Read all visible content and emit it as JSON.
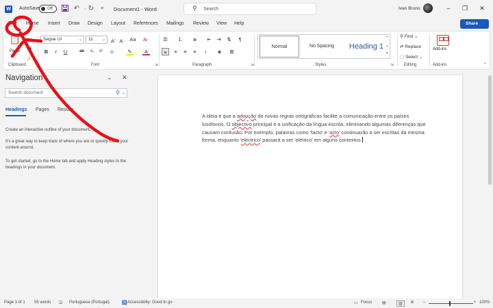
{
  "titlebar": {
    "autosave_label": "AutoSave",
    "autosave_state": "Off",
    "doc_title": "Document1  -  Word",
    "search_placeholder": "Search",
    "user_name": "Ivan Bruno",
    "save_icon": "save-icon",
    "undo_icon": "undo-icon",
    "redo_icon": "redo-icon"
  },
  "menu": {
    "tabs": [
      "File",
      "Home",
      "Insert",
      "Draw",
      "Design",
      "Layout",
      "References",
      "Mailings",
      "Review",
      "View",
      "Help"
    ],
    "share_label": "Share"
  },
  "ribbon": {
    "clipboard": {
      "label": "Clipboard",
      "paste_label": "Paste"
    },
    "font": {
      "label": "Font",
      "font_name": "Segoe UI",
      "font_size": "11",
      "change_case": "Aa"
    },
    "paragraph": {
      "label": "Paragraph"
    },
    "styles": {
      "label": "Styles",
      "items": [
        "Normal",
        "No Spacing",
        "Heading 1"
      ]
    },
    "editing": {
      "label": "Editing",
      "find": "Find",
      "replace": "Replace",
      "select": "Select"
    },
    "addins": {
      "label": "Add-ins",
      "button_label": "Add-ins"
    },
    "accent_color": "#185abd"
  },
  "nav": {
    "title": "Navigation",
    "search_placeholder": "Search document",
    "tabs": [
      "Headings",
      "Pages",
      "Results"
    ],
    "active_tab": "Headings",
    "texts": [
      "Create an interactive outline of your document.",
      "It's a great way to keep track of where you are or quickly move your content around.",
      "To get started, go to the Home tab and apply Heading styles to the headings in your document."
    ]
  },
  "document": {
    "segments": [
      {
        "t": "A ideia é que a ",
        "s": false
      },
      {
        "t": "adopção",
        "s": true
      },
      {
        "t": " de novas regras ortográficas facilite a comunicação entre os países lusófonos. O ",
        "s": false
      },
      {
        "t": "objectivo",
        "s": true
      },
      {
        "t": " principal é a unificação da língua escrita, eliminando algumas diferenças que causam confusão. Por exemplo, palavras como 'facto' e '",
        "s": false
      },
      {
        "t": "acto",
        "s": true
      },
      {
        "t": "' continuarão a ser escritas da mesma forma, enquanto '",
        "s": false
      },
      {
        "t": "eléctrico",
        "s": true
      },
      {
        "t": "' passará a ser 'elétrico' em alguns contextos.",
        "s": false
      }
    ]
  },
  "status": {
    "page": "Page 1 of 1",
    "words": "55 words",
    "language": "Portuguese (Portugal)",
    "accessibility": "Accessibility: Good to go",
    "focus": "Focus",
    "zoom": "100%"
  },
  "annotation_color": "#e8101a"
}
